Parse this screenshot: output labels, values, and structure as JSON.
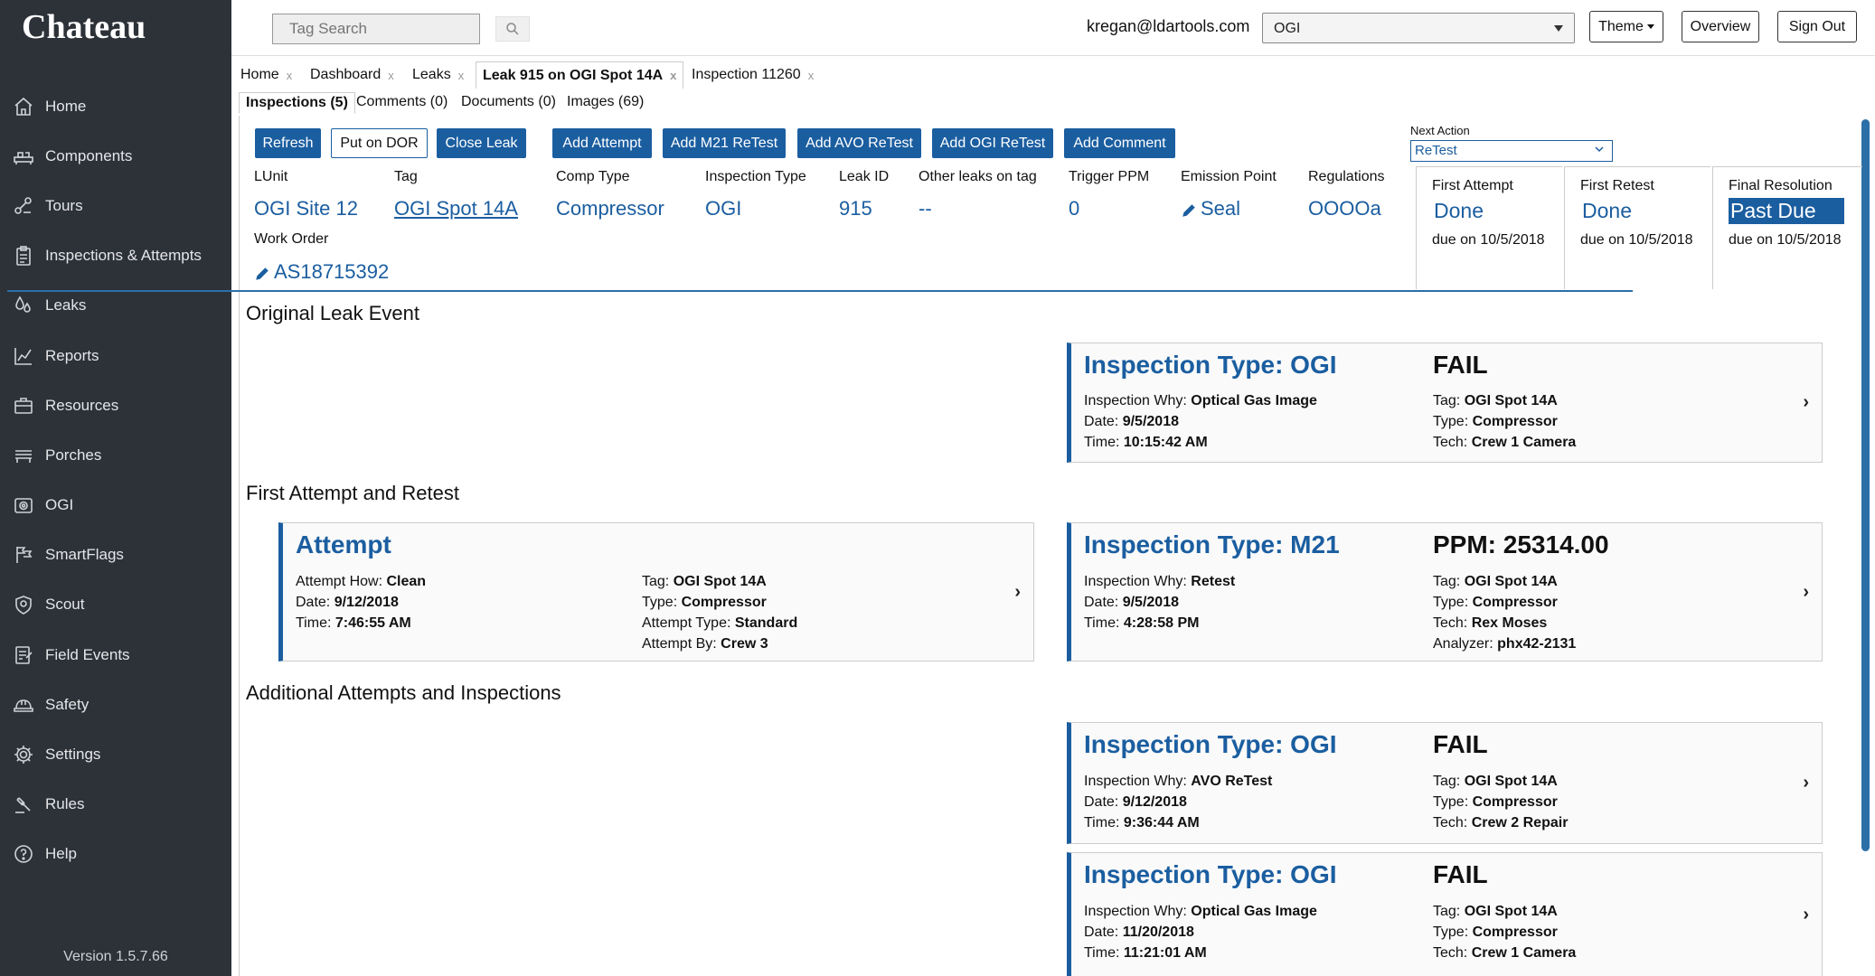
{
  "app": {
    "name": "Chateau",
    "version": "Version 1.5.7.66"
  },
  "sidebar": {
    "items": [
      {
        "label": "Home",
        "icon": "home-icon"
      },
      {
        "label": "Components",
        "icon": "components-icon"
      },
      {
        "label": "Tours",
        "icon": "tours-icon"
      },
      {
        "label": "Inspections & Attempts",
        "icon": "clipboard-icon"
      },
      {
        "label": "Leaks",
        "icon": "droplets-icon"
      },
      {
        "label": "Reports",
        "icon": "chart-icon"
      },
      {
        "label": "Resources",
        "icon": "briefcase-icon"
      },
      {
        "label": "Porches",
        "icon": "bench-icon"
      },
      {
        "label": "OGI",
        "icon": "camera-icon"
      },
      {
        "label": "SmartFlags",
        "icon": "flags-icon"
      },
      {
        "label": "Scout",
        "icon": "shield-icon"
      },
      {
        "label": "Field Events",
        "icon": "form-icon"
      },
      {
        "label": "Safety",
        "icon": "hardhat-icon"
      },
      {
        "label": "Settings",
        "icon": "gear-icon"
      },
      {
        "label": "Rules",
        "icon": "gavel-icon"
      },
      {
        "label": "Help",
        "icon": "help-icon"
      }
    ]
  },
  "topbar": {
    "search_placeholder": "Tag Search",
    "user_email": "kregan@ldartools.com",
    "org": "OGI",
    "theme_label": "Theme",
    "overview_label": "Overview",
    "signout_label": "Sign Out"
  },
  "tabs": [
    {
      "label": "Home"
    },
    {
      "label": "Dashboard"
    },
    {
      "label": "Leaks"
    },
    {
      "label": "Leak 915 on OGI Spot 14A"
    },
    {
      "label": "Inspection 11260"
    }
  ],
  "subtabs": [
    {
      "label": "Inspections (5)"
    },
    {
      "label": "Comments (0)"
    },
    {
      "label": "Documents (0)"
    },
    {
      "label": "Images (69)"
    }
  ],
  "actions": {
    "refresh": "Refresh",
    "put_on_dor": "Put on DOR",
    "close_leak": "Close Leak",
    "add_attempt": "Add Attempt",
    "add_m21": "Add M21 ReTest",
    "add_avo": "Add AVO ReTest",
    "add_ogi": "Add OGI ReTest",
    "add_comment": "Add Comment",
    "next_action_label": "Next Action",
    "next_action_value": "ReTest"
  },
  "leak_info": {
    "lunit": {
      "label": "LUnit",
      "value": "OGI Site 12"
    },
    "tag": {
      "label": "Tag",
      "value": "OGI Spot 14A"
    },
    "comp_type": {
      "label": "Comp Type",
      "value": "Compressor"
    },
    "inspection_type": {
      "label": "Inspection Type",
      "value": "OGI"
    },
    "leak_id": {
      "label": "Leak ID",
      "value": "915"
    },
    "other_leaks": {
      "label": "Other leaks on tag",
      "value": "--"
    },
    "trigger_ppm": {
      "label": "Trigger PPM",
      "value": "0"
    },
    "emission_point": {
      "label": "Emission Point",
      "value": "Seal"
    },
    "regulations": {
      "label": "Regulations",
      "value": "OOOOa"
    },
    "work_order": {
      "label": "Work Order",
      "value": "AS18715392"
    }
  },
  "status": {
    "first_attempt": {
      "label": "First Attempt",
      "value": "Done",
      "due": "due on 10/5/2018"
    },
    "first_retest": {
      "label": "First Retest",
      "value": "Done",
      "due": "due on 10/5/2018"
    },
    "final_resolution": {
      "label": "Final Resolution",
      "value": "Past Due",
      "due": "due on 10/5/2018"
    }
  },
  "sections": {
    "original": "Original Leak Event",
    "first": "First Attempt and Retest",
    "additional": "Additional Attempts and Inspections"
  },
  "cards": {
    "original_ogi": {
      "title": "Inspection Type: OGI",
      "result": "FAIL",
      "why_label": "Inspection Why:",
      "why": "Optical Gas Image",
      "date_label": "Date:",
      "date": "9/5/2018",
      "time_label": "Time:",
      "time": "10:15:42 AM",
      "tag_label": "Tag:",
      "tag": "OGI Spot 14A",
      "type_label": "Type:",
      "type": "Compressor",
      "tech_label": "Tech:",
      "tech": "Crew 1 Camera"
    },
    "attempt": {
      "title": "Attempt",
      "how_label": "Attempt How:",
      "how": "Clean",
      "date_label": "Date:",
      "date": "9/12/2018",
      "time_label": "Time:",
      "time": "7:46:55 AM",
      "tag_label": "Tag:",
      "tag": "OGI Spot 14A",
      "type_label": "Type:",
      "type": "Compressor",
      "atype_label": "Attempt Type:",
      "atype": "Standard",
      "by_label": "Attempt By:",
      "by": "Crew 3"
    },
    "m21": {
      "title": "Inspection Type: M21",
      "result": "PPM: 25314.00",
      "why_label": "Inspection Why:",
      "why": "Retest",
      "date_label": "Date:",
      "date": "9/5/2018",
      "time_label": "Time:",
      "time": "4:28:58 PM",
      "tag_label": "Tag:",
      "tag": "OGI Spot 14A",
      "type_label": "Type:",
      "type": "Compressor",
      "tech_label": "Tech:",
      "tech": "Rex Moses",
      "analyzer_label": "Analyzer:",
      "analyzer": "phx42-2131"
    },
    "ogi_avo": {
      "title": "Inspection Type: OGI",
      "result": "FAIL",
      "why_label": "Inspection Why:",
      "why": "AVO ReTest",
      "date_label": "Date:",
      "date": "9/12/2018",
      "time_label": "Time:",
      "time": "9:36:44 AM",
      "tag_label": "Tag:",
      "tag": "OGI Spot 14A",
      "type_label": "Type:",
      "type": "Compressor",
      "tech_label": "Tech:",
      "tech": "Crew 2 Repair"
    },
    "ogi_last": {
      "title": "Inspection Type: OGI",
      "result": "FAIL",
      "why_label": "Inspection Why:",
      "why": "Optical Gas Image",
      "date_label": "Date:",
      "date": "11/20/2018",
      "time_label": "Time:",
      "time": "11:21:01 AM",
      "tag_label": "Tag:",
      "tag": "OGI Spot 14A",
      "type_label": "Type:",
      "type": "Compressor",
      "tech_label": "Tech:",
      "tech": "Crew 1 Camera"
    }
  },
  "colors": {
    "sidebar": "#2d3138",
    "accent": "#1b5ea0"
  }
}
